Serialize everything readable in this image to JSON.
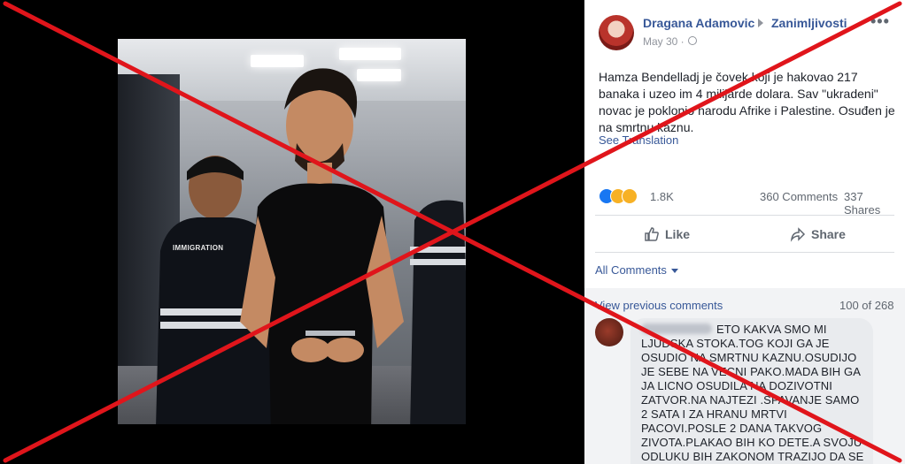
{
  "post": {
    "author": "Dragana Adamovic",
    "group": "Zanimljivosti",
    "more": "•••",
    "date": "May 30 ·",
    "privacy_icon": "globe-icon",
    "text": "Hamza Bendelladj je čovek koji je hakovao 217 banaka i uzeo im 4 milijarde dolara. Sav \"ukradeni\" novac je poklonio narodu Afrike i Palestine. Osuđen je na smrtnu kaznu.",
    "see_translation": "See Translation",
    "photo_tag": "IMMIGRATION"
  },
  "stats": {
    "reactions": [
      "like-reaction-icon",
      "sad-reaction-icon",
      "wow-reaction-icon"
    ],
    "reaction_count": "1.8K",
    "comments": "360 Comments",
    "shares": "337 Shares"
  },
  "actions": {
    "like": "Like",
    "share": "Share"
  },
  "comments": {
    "filter": "All Comments",
    "view_previous": "View previous comments",
    "pager": "100 of 268",
    "first_comment": "ETO KAKVA SMO MI LJUDSKA STOKA.TOG KOJI GA JE OSUDIO NA SMRTNU KAZNU.OSUDIJO JE SEBE NA VECNI PAKO.MADA BIH GA JA LICNO OSUDILA NA DOZIVOTNI ZATVOR.NA NAJTEZI .SPAVANJE SAMO 2 SATA I ZA HRANU MRTVI PACOVI.POSLE 2 DANA TAKVOG ZIVOTA.PLAKAO BIH KO DETE.A SVOJU ODLUKU BIH ZAKONOM TRAZIJO DA SE ZABRANI.DECKO JE"
  },
  "colors": {
    "link_blue": "#385898",
    "cross_red": "#e0151b",
    "meta_gray": "#606770"
  }
}
